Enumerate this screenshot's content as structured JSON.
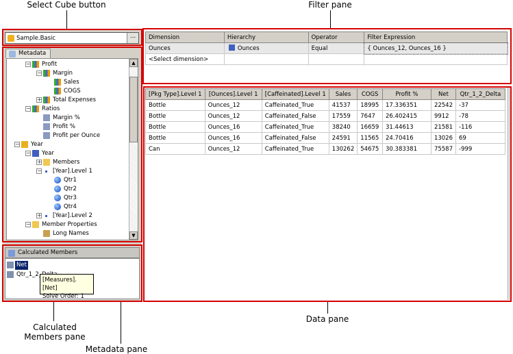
{
  "callouts": {
    "select_cube": "Select Cube button",
    "filter_pane": "Filter pane",
    "calculated_members_pane_line1": "Calculated",
    "calculated_members_pane_line2": "Members pane",
    "metadata_pane": "Metadata pane",
    "data_pane": "Data pane",
    "highlight_color": "#d40000"
  },
  "cube": {
    "name": "Sample.Basic",
    "browse_label": "..."
  },
  "metadata": {
    "tab_label": "Metadata",
    "tree": [
      {
        "label": "Profit",
        "depth": 2,
        "expander": "minus",
        "icon": "measure-icon"
      },
      {
        "label": "Margin",
        "depth": 3,
        "expander": "minus",
        "icon": "measure-icon"
      },
      {
        "label": "Sales",
        "depth": 4,
        "expander": "",
        "icon": "measure-icon"
      },
      {
        "label": "COGS",
        "depth": 4,
        "expander": "",
        "icon": "measure-icon"
      },
      {
        "label": "Total Expenses",
        "depth": 3,
        "expander": "plus",
        "icon": "measure-icon"
      },
      {
        "label": "Ratios",
        "depth": 2,
        "expander": "minus",
        "icon": "measure-icon"
      },
      {
        "label": "Margin %",
        "depth": 3,
        "expander": "",
        "icon": "calculated-measure-icon"
      },
      {
        "label": "Profit %",
        "depth": 3,
        "expander": "",
        "icon": "calculated-measure-icon"
      },
      {
        "label": "Profit per Ounce",
        "depth": 3,
        "expander": "",
        "icon": "calculated-measure-icon"
      },
      {
        "label": "Year",
        "depth": 1,
        "expander": "minus",
        "icon": "dimension-icon"
      },
      {
        "label": "Year",
        "depth": 2,
        "expander": "minus",
        "icon": "hierarchy-icon"
      },
      {
        "label": "Members",
        "depth": 3,
        "expander": "plus",
        "icon": "members-folder-icon"
      },
      {
        "label": "[Year].Level 1",
        "depth": 3,
        "expander": "minus",
        "icon": "level-icon"
      },
      {
        "label": "Qtr1",
        "depth": 4,
        "expander": "",
        "icon": "member-icon"
      },
      {
        "label": "Qtr2",
        "depth": 4,
        "expander": "",
        "icon": "member-icon"
      },
      {
        "label": "Qtr3",
        "depth": 4,
        "expander": "",
        "icon": "member-icon"
      },
      {
        "label": "Qtr4",
        "depth": 4,
        "expander": "",
        "icon": "member-icon"
      },
      {
        "label": "[Year].Level 2",
        "depth": 3,
        "expander": "plus",
        "icon": "level-icon"
      },
      {
        "label": "Member Properties",
        "depth": 2,
        "expander": "minus",
        "icon": "folder-icon"
      },
      {
        "label": "Long Names",
        "depth": 3,
        "expander": "",
        "icon": "property-icon"
      }
    ]
  },
  "calculated_members": {
    "header": "Calculated Members",
    "items": [
      {
        "label": "Net",
        "selected": true
      },
      {
        "label": "Qtr_1_2_Delta",
        "selected": false
      }
    ],
    "tooltip": {
      "line1": "[Measures].[Net]",
      "line2": "Solve Order: 1"
    }
  },
  "filter": {
    "columns": [
      "Dimension",
      "Hierarchy",
      "Operator",
      "Filter Expression"
    ],
    "rows": [
      [
        "Ounces",
        "Ounces",
        "Equal",
        "{ Ounces_12, Ounces_16 }"
      ],
      [
        "<Select dimension>",
        "",
        "",
        ""
      ]
    ]
  },
  "data": {
    "columns": [
      "[Pkg Type].Level 1",
      "[Ounces].Level 1",
      "[Caffeinated].Level 1",
      "Sales",
      "COGS",
      "Profit %",
      "Net",
      "Qtr_1_2_Delta"
    ],
    "rows": [
      [
        "Bottle",
        "Ounces_12",
        "Caffeinated_True",
        "41537",
        "18995",
        "17.336351",
        "22542",
        "-37"
      ],
      [
        "Bottle",
        "Ounces_12",
        "Caffeinated_False",
        "17559",
        "7647",
        "26.402415",
        "9912",
        "-78"
      ],
      [
        "Bottle",
        "Ounces_16",
        "Caffeinated_True",
        "38240",
        "16659",
        "31.44613",
        "21581",
        "-116"
      ],
      [
        "Bottle",
        "Ounces_16",
        "Caffeinated_False",
        "24591",
        "11565",
        "24.70416",
        "13026",
        "69"
      ],
      [
        "Can",
        "Ounces_12",
        "Caffeinated_True",
        "130262",
        "54675",
        "30.383381",
        "75587",
        "-999"
      ]
    ]
  }
}
